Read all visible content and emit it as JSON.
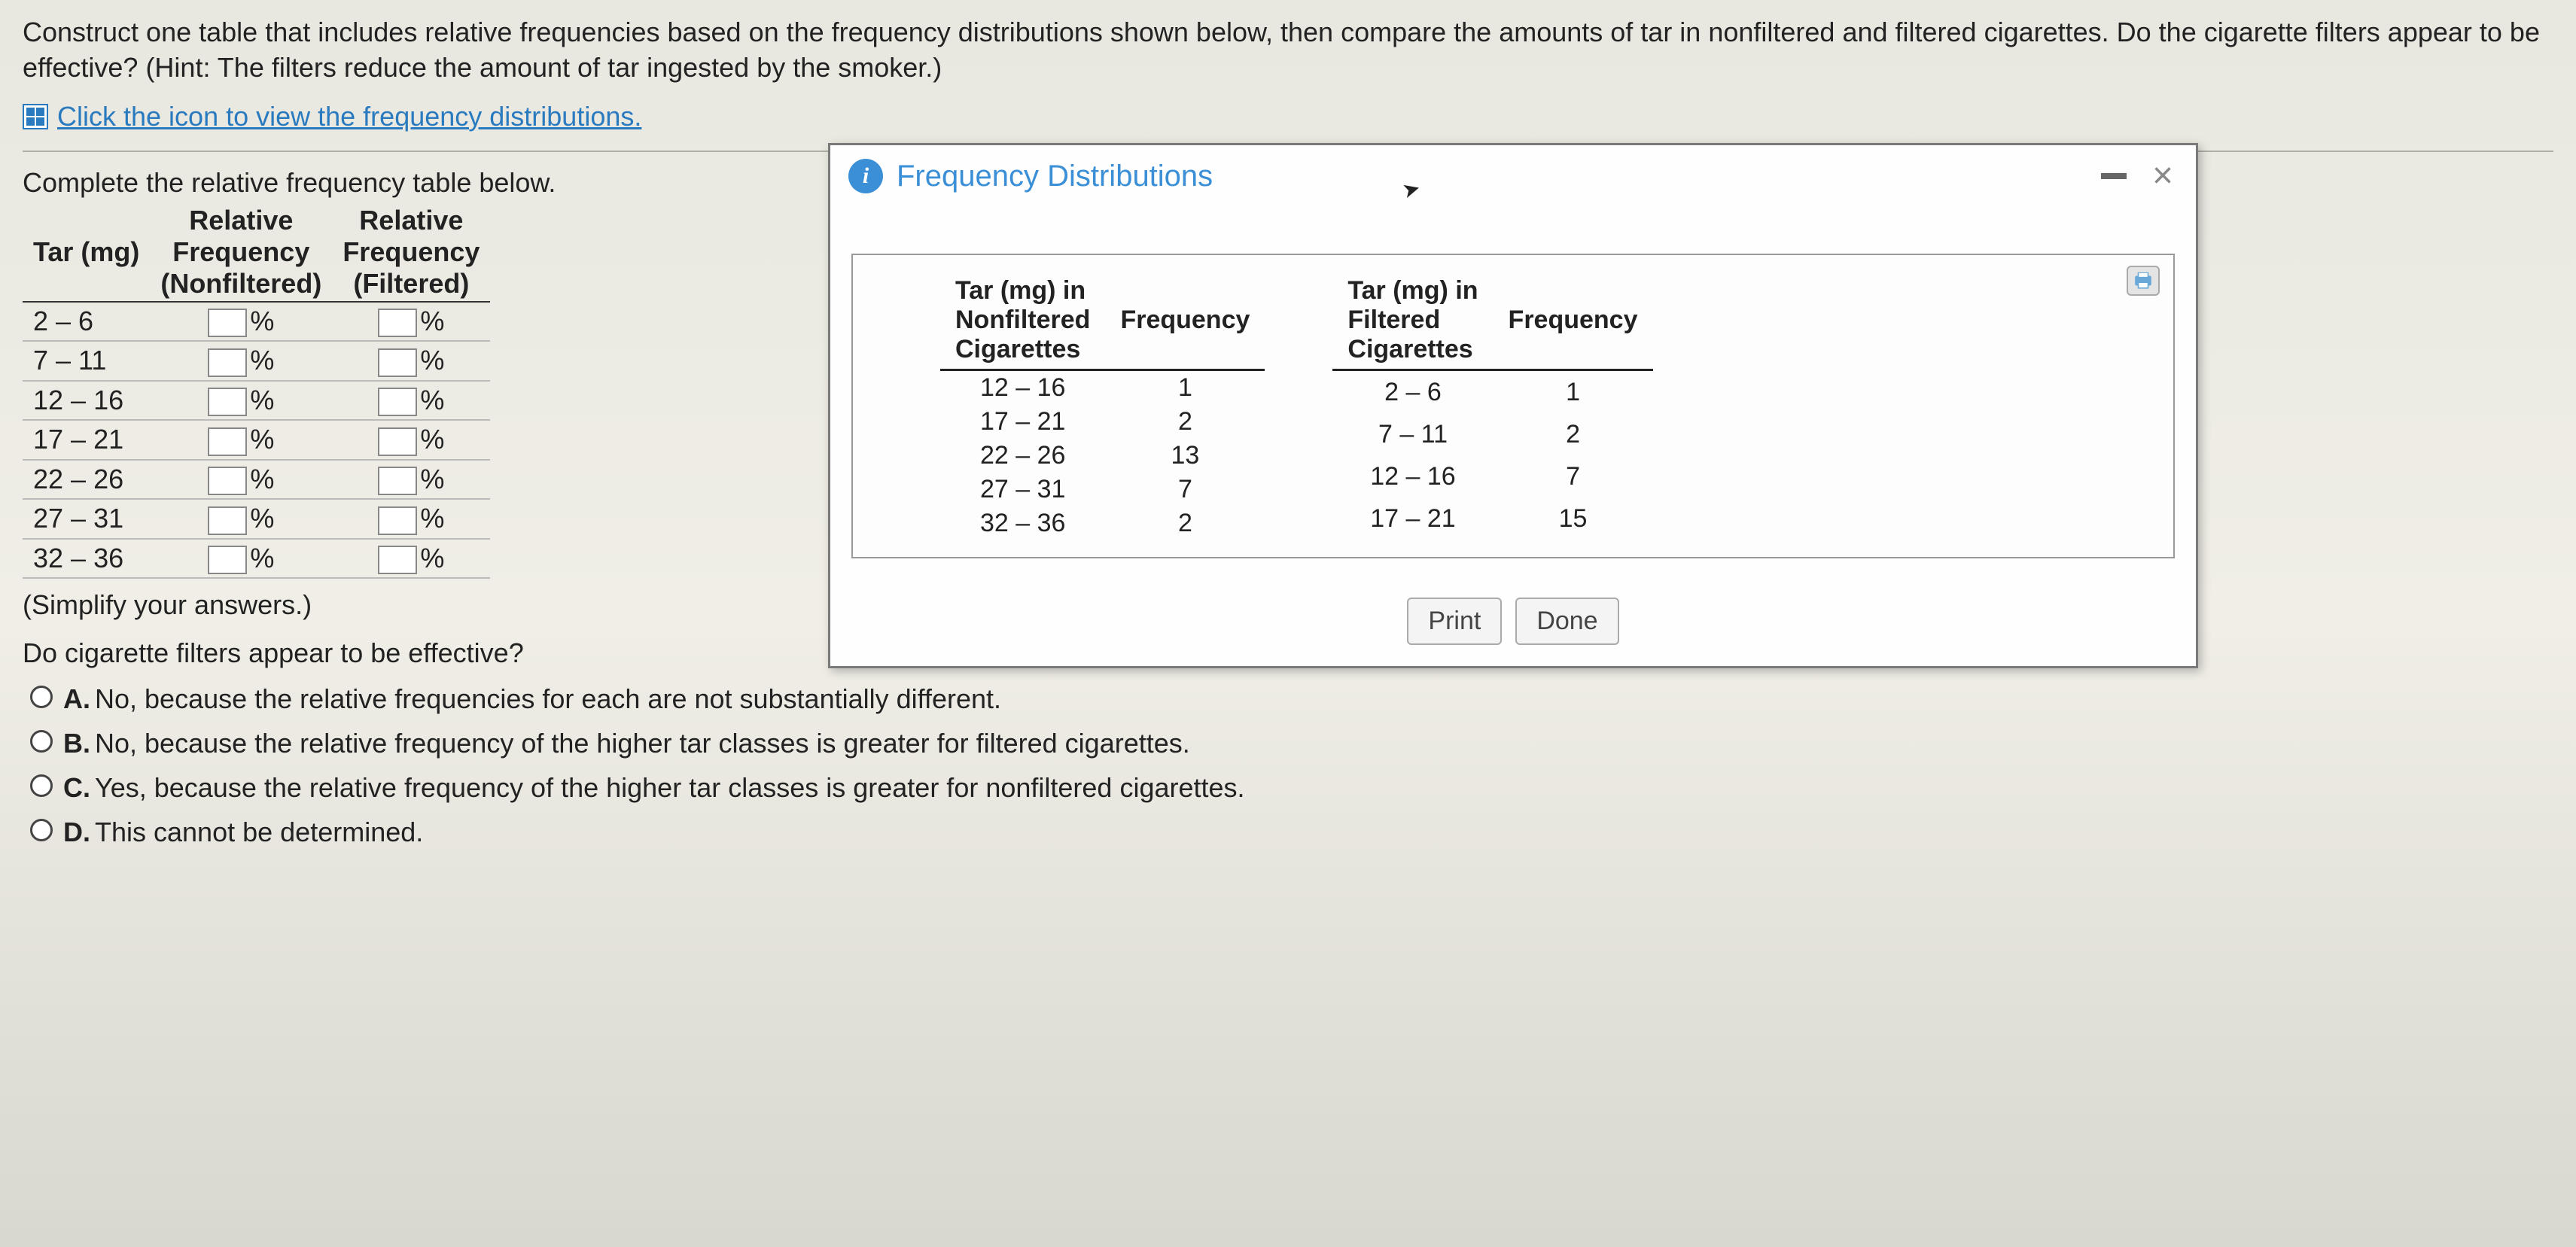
{
  "question": "Construct one table that includes relative frequencies based on the frequency distributions shown below, then compare the amounts of tar in nonfiltered and filtered cigarettes. Do the cigarette filters appear to be effective? (Hint: The filters reduce the amount of tar ingested by the smoker.)",
  "icon_link": "Click the icon to view the frequency distributions.",
  "complete_heading": "Complete the relative frequency table below.",
  "rel_table": {
    "headers": {
      "tar": "Tar (mg)",
      "nonf": "Relative\nFrequency\n(Nonfiltered)",
      "filt": "Relative\nFrequency\n(Filtered)"
    },
    "rows": [
      "2 – 6",
      "7 – 11",
      "12 – 16",
      "17 – 21",
      "22 – 26",
      "27 – 31",
      "32 – 36"
    ],
    "unit": "%"
  },
  "simplify_hint": "(Simplify your answers.)",
  "subquestion": "Do cigarette filters appear to be effective?",
  "options": {
    "A": "No, because the relative frequencies for each are not substantially different.",
    "B": "No, because the relative frequency of the higher tar classes is greater for filtered cigarettes.",
    "C": "Yes, because the relative frequency of the higher tar classes is greater for nonfiltered cigarettes.",
    "D": "This cannot be determined."
  },
  "popup": {
    "title": "Frequency Distributions",
    "nonfiltered": {
      "col1": "Tar (mg) in\nNonfiltered\nCigarettes",
      "col2": "Frequency",
      "rows": [
        {
          "range": "12 – 16",
          "freq": 1
        },
        {
          "range": "17 – 21",
          "freq": 2
        },
        {
          "range": "22 – 26",
          "freq": 13
        },
        {
          "range": "27 – 31",
          "freq": 7
        },
        {
          "range": "32 – 36",
          "freq": 2
        }
      ]
    },
    "filtered": {
      "col1": "Tar (mg) in\nFiltered\nCigarettes",
      "col2": "Frequency",
      "rows": [
        {
          "range": "2 – 6",
          "freq": 1
        },
        {
          "range": "7 – 11",
          "freq": 2
        },
        {
          "range": "12 – 16",
          "freq": 7
        },
        {
          "range": "17 – 21",
          "freq": 15
        }
      ]
    },
    "buttons": {
      "print": "Print",
      "done": "Done"
    }
  },
  "chart_data": [
    {
      "type": "table",
      "title": "Nonfiltered Cigarettes Frequency Distribution",
      "categories": [
        "12 – 16",
        "17 – 21",
        "22 – 26",
        "27 – 31",
        "32 – 36"
      ],
      "values": [
        1,
        2,
        13,
        7,
        2
      ]
    },
    {
      "type": "table",
      "title": "Filtered Cigarettes Frequency Distribution",
      "categories": [
        "2 – 6",
        "7 – 11",
        "12 – 16",
        "17 – 21"
      ],
      "values": [
        1,
        2,
        7,
        15
      ]
    }
  ]
}
